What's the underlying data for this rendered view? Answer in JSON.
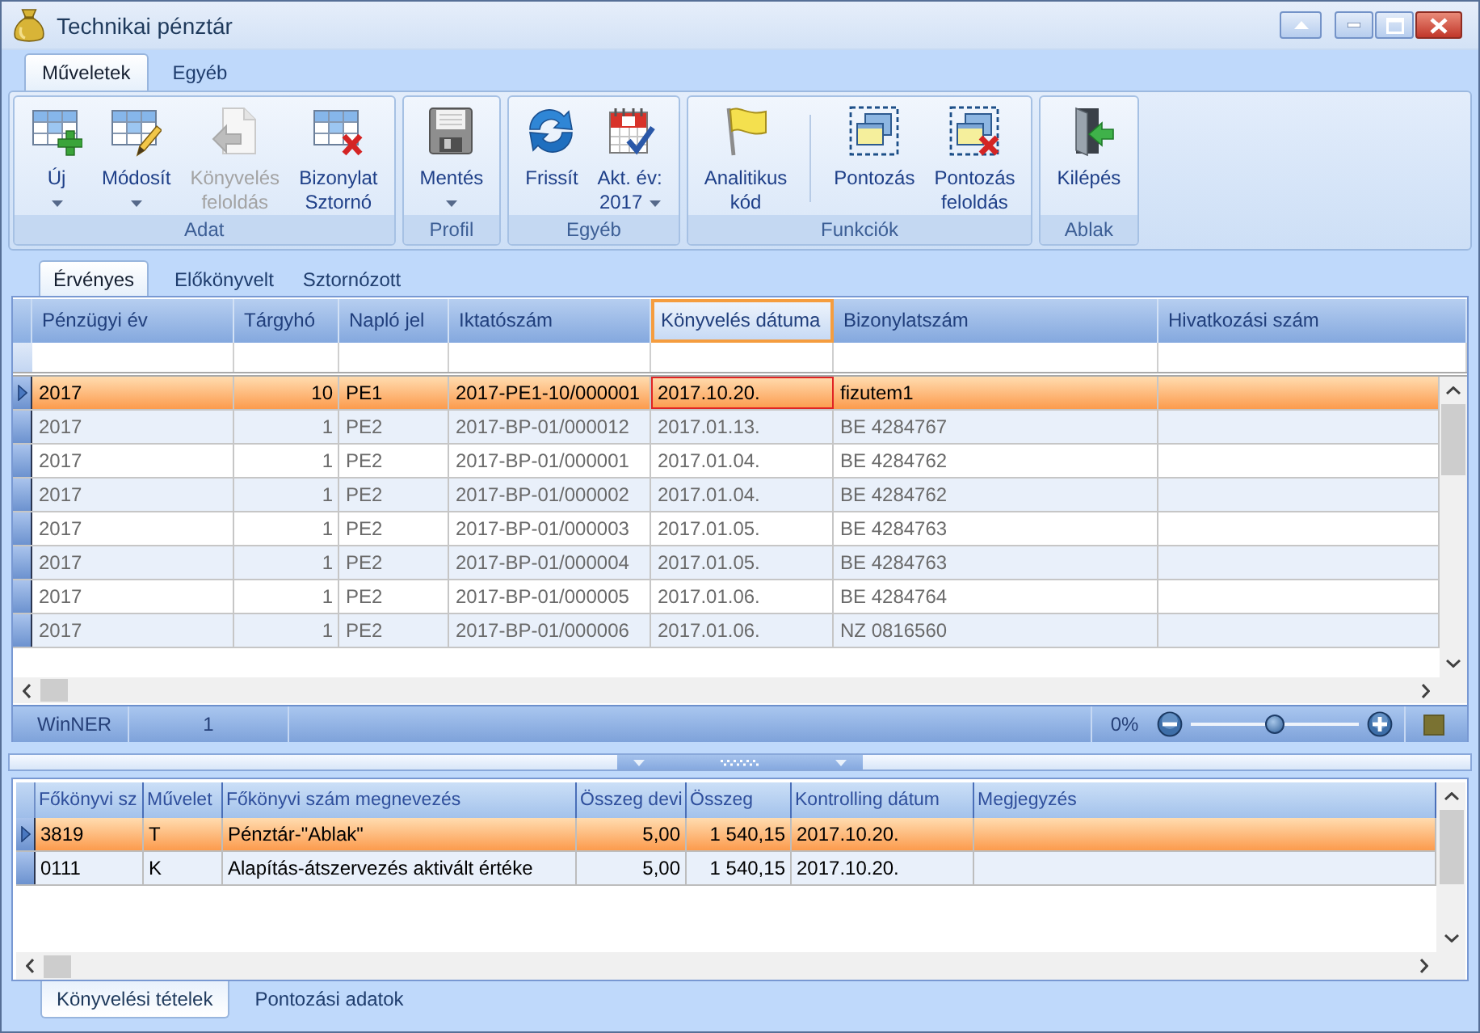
{
  "window": {
    "title": "Technikai pénztár"
  },
  "ribbon": {
    "tabs": [
      {
        "label": "Műveletek",
        "selected": true
      },
      {
        "label": "Egyéb",
        "selected": false
      }
    ],
    "groups": [
      {
        "label": "Adat",
        "buttons": [
          {
            "kind": "new",
            "label": "Új",
            "dropdown": true,
            "disabled": false
          },
          {
            "kind": "edit",
            "label": "Módosít",
            "dropdown": true,
            "disabled": false
          },
          {
            "kind": "unpost",
            "label": "Könyvelés\nfeloldás",
            "dropdown": false,
            "disabled": true
          },
          {
            "kind": "reverse",
            "label": "Bizonylat\nSztornó",
            "dropdown": false,
            "disabled": false
          }
        ]
      },
      {
        "label": "Profil",
        "buttons": [
          {
            "kind": "save",
            "label": "Mentés",
            "dropdown": true,
            "disabled": false
          }
        ]
      },
      {
        "label": "Egyéb",
        "buttons": [
          {
            "kind": "refresh",
            "label": "Frissít",
            "dropdown": false,
            "disabled": false
          },
          {
            "kind": "calendar",
            "label": "Akt. év:\n2017",
            "dropdown": true,
            "disabled": false
          }
        ]
      },
      {
        "label": "Funkciók",
        "buttons": [
          {
            "kind": "flag",
            "label": "Analitikus\nkód",
            "dropdown": false,
            "disabled": false
          },
          {
            "kind": "separator"
          },
          {
            "kind": "mark",
            "label": "Pontozás",
            "dropdown": false,
            "disabled": false
          },
          {
            "kind": "unmark",
            "label": "Pontozás\nfeloldás",
            "dropdown": false,
            "disabled": false
          }
        ]
      },
      {
        "label": "Ablak",
        "buttons": [
          {
            "kind": "exit",
            "label": "Kilépés",
            "dropdown": false,
            "disabled": false
          }
        ]
      }
    ]
  },
  "record_tabs": [
    {
      "label": "Érvényes",
      "selected": true
    },
    {
      "label": "Előkönyvelt",
      "selected": false
    },
    {
      "label": "Sztornózott",
      "selected": false
    }
  ],
  "main_grid": {
    "columns": [
      {
        "label": "Pénzügyi év",
        "kind": "text",
        "selected": false
      },
      {
        "label": "Tárgyhó",
        "kind": "number",
        "selected": false
      },
      {
        "label": "Napló jel",
        "kind": "text",
        "selected": false
      },
      {
        "label": "Iktatószám",
        "kind": "text",
        "selected": false
      },
      {
        "label": "Könyvelés dátuma",
        "kind": "text",
        "selected": true
      },
      {
        "label": "Bizonylatszám",
        "kind": "text",
        "selected": false
      },
      {
        "label": "Hivatkozási szám",
        "kind": "text",
        "selected": false
      }
    ],
    "rows": [
      {
        "selected": true,
        "cells": [
          "2017",
          "10",
          "PE1",
          "2017-PE1-10/000001",
          "2017.10.20.",
          "fizutem1"
        ]
      },
      {
        "selected": false,
        "cells": [
          "2017",
          "1",
          "PE2",
          "2017-BP-01/000012",
          "2017.01.13.",
          "BE 4284767"
        ]
      },
      {
        "selected": false,
        "cells": [
          "2017",
          "1",
          "PE2",
          "2017-BP-01/000001",
          "2017.01.04.",
          "BE 4284762"
        ]
      },
      {
        "selected": false,
        "cells": [
          "2017",
          "1",
          "PE2",
          "2017-BP-01/000002",
          "2017.01.04.",
          "BE 4284762"
        ]
      },
      {
        "selected": false,
        "cells": [
          "2017",
          "1",
          "PE2",
          "2017-BP-01/000003",
          "2017.01.05.",
          "BE 4284763"
        ]
      },
      {
        "selected": false,
        "cells": [
          "2017",
          "1",
          "PE2",
          "2017-BP-01/000004",
          "2017.01.05.",
          "BE 4284763"
        ]
      },
      {
        "selected": false,
        "cells": [
          "2017",
          "1",
          "PE2",
          "2017-BP-01/000005",
          "2017.01.06.",
          "BE 4284764"
        ]
      },
      {
        "selected": false,
        "cells": [
          "2017",
          "1",
          "PE2",
          "2017-BP-01/000006",
          "2017.01.06.",
          "NZ 0816560"
        ]
      }
    ]
  },
  "status_bar": {
    "cells": [
      "WinNER",
      "1"
    ],
    "zoom": {
      "reading": "0%",
      "level": 0.5
    }
  },
  "detail_grid": {
    "columns": [
      {
        "label": "Főkönyvi sz",
        "kind": "text",
        "selected": false
      },
      {
        "label": "Művelet",
        "kind": "text",
        "selected": false
      },
      {
        "label": "Főkönyvi szám megnevezés",
        "kind": "text",
        "selected": false
      },
      {
        "label": "Összeg devi",
        "kind": "number",
        "selected": false
      },
      {
        "label": "Összeg",
        "kind": "number",
        "selected": false
      },
      {
        "label": "Kontrolling dátum",
        "kind": "text",
        "selected": false
      },
      {
        "label": "Megjegyzés",
        "kind": "text",
        "selected": false
      }
    ],
    "rows": [
      {
        "selected": true,
        "cells": [
          "3819",
          "T",
          "Pénztár-\"Ablak\"",
          "5,00",
          "1 540,15",
          "2017.10.20."
        ]
      },
      {
        "selected": false,
        "cells": [
          "0111",
          "K",
          "Alapítás-átszervezés aktivált értéke",
          "5,00",
          "1 540,15",
          "2017.10.20."
        ]
      }
    ]
  },
  "detail_tabs": [
    {
      "label": "Könyvelési tételek",
      "selected": true
    },
    {
      "label": "Pontozási adatok",
      "selected": false
    }
  ]
}
